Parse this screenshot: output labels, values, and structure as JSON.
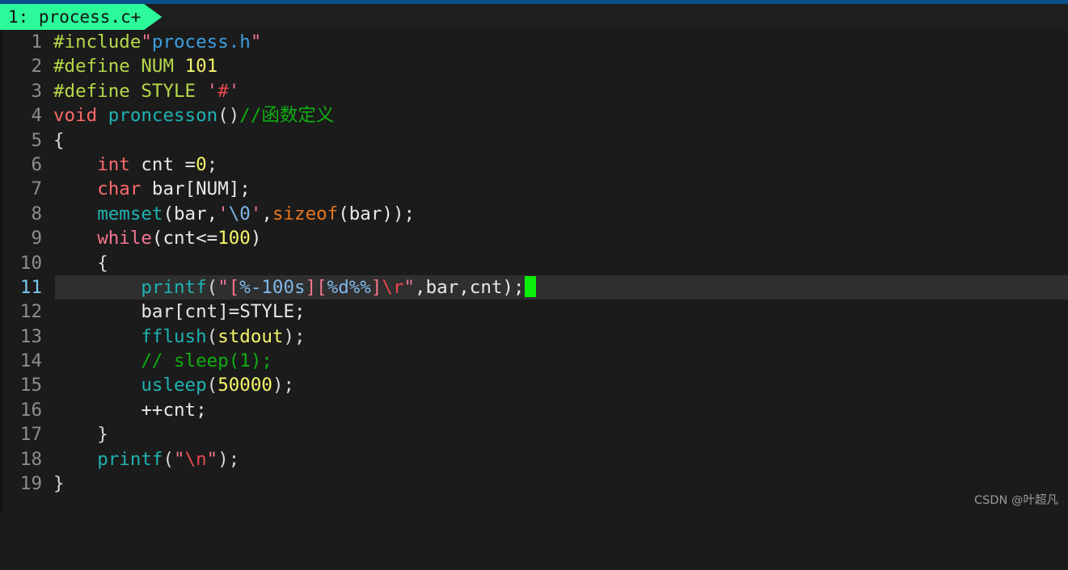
{
  "window": {
    "top_strip_color": "#0b4f8a",
    "editor_bg": "#1b1b1b",
    "tabbar_bg": "#1e1e1e"
  },
  "tab": {
    "label": "1: process.c+",
    "background": "#2bf99a",
    "text_color": "#12130f"
  },
  "editor": {
    "cursor_line": 11,
    "cursor_line_bg": "#2f2f2f",
    "cursor_color": "#0aee0a",
    "gutter_color": "#8d8d8d",
    "gutter_active_color": "#79c9f2",
    "lines": [
      {
        "n": "1",
        "text": "#include\"process.h\""
      },
      {
        "n": "2",
        "text": "#define NUM 101"
      },
      {
        "n": "3",
        "text": "#define STYLE '#'"
      },
      {
        "n": "4",
        "text": "void proncesson()//函数定义"
      },
      {
        "n": "5",
        "text": "{"
      },
      {
        "n": "6",
        "text": "    int cnt =0;"
      },
      {
        "n": "7",
        "text": "    char bar[NUM];"
      },
      {
        "n": "8",
        "text": "    memset(bar,'\\0',sizeof(bar));"
      },
      {
        "n": "9",
        "text": "    while(cnt<=100)"
      },
      {
        "n": "10",
        "text": "    {"
      },
      {
        "n": "11",
        "text": "        printf(\"[%-100s][%d%%]\\r\",bar,cnt);"
      },
      {
        "n": "12",
        "text": "        bar[cnt]=STYLE;"
      },
      {
        "n": "13",
        "text": "        fflush(stdout);"
      },
      {
        "n": "14",
        "text": "        // sleep(1);"
      },
      {
        "n": "15",
        "text": "        usleep(50000);"
      },
      {
        "n": "16",
        "text": "        ++cnt;"
      },
      {
        "n": "17",
        "text": "    }"
      },
      {
        "n": "18",
        "text": "    printf(\"\\n\");"
      },
      {
        "n": "19",
        "text": "}"
      }
    ],
    "tokens": {
      "l1": {
        "a": "#include",
        "b": "\"",
        "c": "process.h",
        "d": "\""
      },
      "l2": {
        "a": "#define",
        "b": " NUM ",
        "c": "101"
      },
      "l3": {
        "a": "#define",
        "b": " STYLE ",
        "c": "'",
        "d": "#",
        "e": "'"
      },
      "l4": {
        "a": "void",
        "b": " ",
        "c": "proncesson",
        "d": "()",
        "e": "//函数定义"
      },
      "l5": {
        "a": "{"
      },
      "l6": {
        "indent": "    ",
        "a": "int",
        "b": " cnt =",
        "c": "0",
        "d": ";"
      },
      "l7": {
        "indent": "    ",
        "a": "char",
        "b": " bar[NUM];"
      },
      "l8": {
        "indent": "    ",
        "a": "memset",
        "b": "(bar,",
        "c": "'",
        "d": "\\0",
        "e": "'",
        "f": ",",
        "g": "sizeof",
        "h": "(bar));"
      },
      "l9": {
        "indent": "    ",
        "a": "while",
        "b": "(cnt<=",
        "c": "100",
        "d": ")"
      },
      "l10": {
        "indent": "    ",
        "a": "{"
      },
      "l11": {
        "indent": "        ",
        "a": "printf",
        "b": "(",
        "c": "\"[",
        "d": "%-100s",
        "e": "][",
        "f": "%d%%",
        "g": "]",
        "h": "\\r",
        "i": "\"",
        "j": ",bar,cnt);"
      },
      "l12": {
        "indent": "        ",
        "a": "bar[cnt]=STYLE;"
      },
      "l13": {
        "indent": "        ",
        "a": "fflush",
        "b": "(",
        "c": "stdout",
        "d": ");"
      },
      "l14": {
        "indent": "        ",
        "a": "// sleep(1);"
      },
      "l15": {
        "indent": "        ",
        "a": "usleep",
        "b": "(",
        "c": "50000",
        "d": ");"
      },
      "l16": {
        "indent": "        ",
        "a": "++cnt;"
      },
      "l17": {
        "indent": "    ",
        "a": "}"
      },
      "l18": {
        "indent": "    ",
        "a": "printf",
        "b": "(",
        "c": "\"",
        "d": "\\n",
        "e": "\"",
        "f": ");"
      },
      "l19": {
        "a": "}"
      }
    }
  },
  "watermark": {
    "text": "CSDN @叶超凡"
  }
}
